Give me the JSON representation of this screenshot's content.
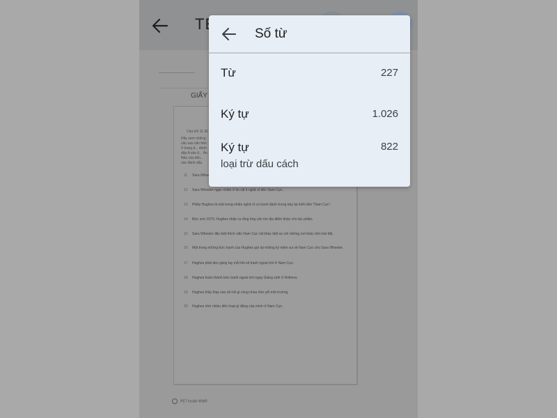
{
  "app_bar": {
    "title": "TE"
  },
  "document": {
    "heading": "GIẤY 1:",
    "question_label": "Câu hỏi 11-20",
    "intro_text": "Hãy xem những câu sau văn bản ở trang đ... đánh dấu A vào ô... Ăn. Nếu câu tiên... vào đánh dấu",
    "statements": [
      {
        "num": "11",
        "text": "Sara Wheeler ..."
      },
      {
        "num": "12",
        "text": "Sara Wheeler ngạc nhiên ở tín rất ít nghệ sĩ đến Nam Cực."
      },
      {
        "num": "13",
        "text": "Philip Hughes là một trong nhiều nghệ sĩ có tranh đánh trưng bày tại triển lãm \"Nam Cực\"."
      },
      {
        "num": "14",
        "text": "Bức sơn 1979, Hughes nhận ra rằng ông cần tìm địa điểm khác cho tác phẩm."
      },
      {
        "num": "15",
        "text": "Sara Wheeler đặc biệt thích việc Nam Cực rất khác biệt so với những nơi khác trên trái đất."
      },
      {
        "num": "16",
        "text": "Một trong những bức tranh của Hughes gợi lại những ký niệm vui về Nam Cực cho Sara Wheeler."
      },
      {
        "num": "17",
        "text": "Hughes phải đeo găng tay mỗi khi vẽ tranh ngoài trời ở Nam Cực."
      },
      {
        "num": "18",
        "text": "Hughes hoàn thành bức tranh ngoài trời ngay Giáng sinh ở Rothera."
      },
      {
        "num": "19",
        "text": "Hughes thấy thay vào vẽ nổi gì công nhau hồn yết môi trường."
      },
      {
        "num": "20",
        "text": "Hughes nhớ nhiều đến hoạt gì động của mình ở Nam Cực."
      }
    ],
    "footer": "PET Inside WWR"
  },
  "dialog": {
    "title": "Số từ",
    "rows": [
      {
        "label": "Từ",
        "value": "227"
      },
      {
        "label": "Ký tự",
        "value": "1.026"
      },
      {
        "label": "Ký tự",
        "value": "822",
        "sublabel": "loại trừ dấu cách"
      }
    ]
  },
  "colors": {
    "overlay": "#a9a9a9",
    "dialog_bg": "#e8eef5",
    "text_primary": "#202124",
    "text_secondary": "#3c4043"
  },
  "icons": {
    "app_back": "arrow-left-icon",
    "dialog_back": "arrow-left-icon"
  }
}
